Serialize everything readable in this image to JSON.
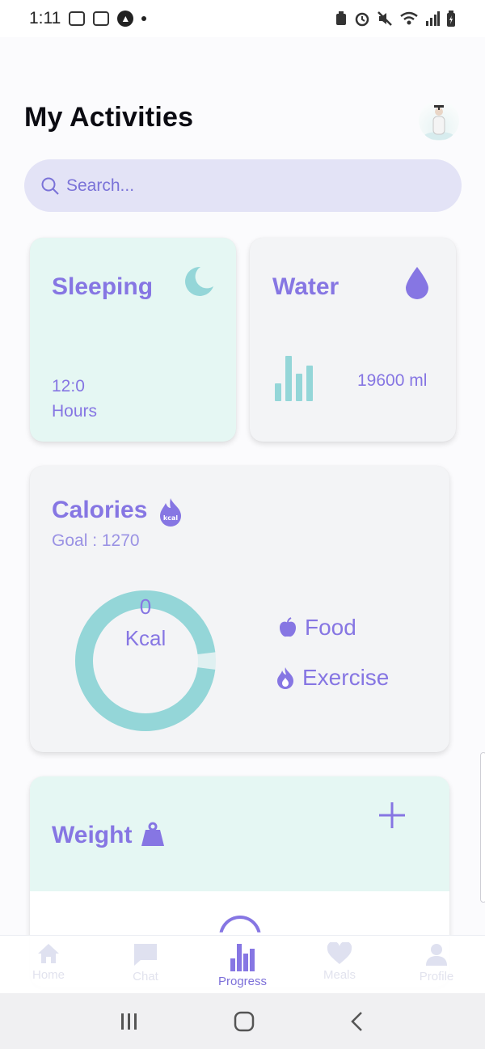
{
  "status_bar": {
    "time": "1:11"
  },
  "header": {
    "title": "My Activities"
  },
  "search": {
    "placeholder": "Search..."
  },
  "sleeping": {
    "title": "Sleeping",
    "value": "12:0",
    "unit": "Hours",
    "icon": "moon-icon"
  },
  "water": {
    "title": "Water",
    "value": "19600 ml",
    "icon": "water-drop-icon"
  },
  "calories": {
    "title": "Calories",
    "goal": "Goal : 1270",
    "value": "0",
    "unit": "Kcal",
    "progress_fraction": 0.04,
    "legend": [
      {
        "label": "Food",
        "icon": "apple-icon"
      },
      {
        "label": "Exercise",
        "icon": "flame-icon"
      }
    ]
  },
  "weight": {
    "title": "Weight",
    "icon": "weight-icon"
  },
  "bottom_nav": [
    {
      "label": "Home",
      "icon": "home-icon",
      "active": false
    },
    {
      "label": "Chat",
      "icon": "chat-icon",
      "active": false
    },
    {
      "label": "Progress",
      "icon": "bar-chart-icon",
      "active": true
    },
    {
      "label": "Meals",
      "icon": "heart-icon",
      "active": false
    },
    {
      "label": "Profile",
      "icon": "profile-icon",
      "active": false
    }
  ],
  "colors": {
    "accent": "#8676e3",
    "teal": "#94d6d8",
    "search_bg": "#e3e3f6",
    "mint_bg": "#e5f7f3"
  }
}
